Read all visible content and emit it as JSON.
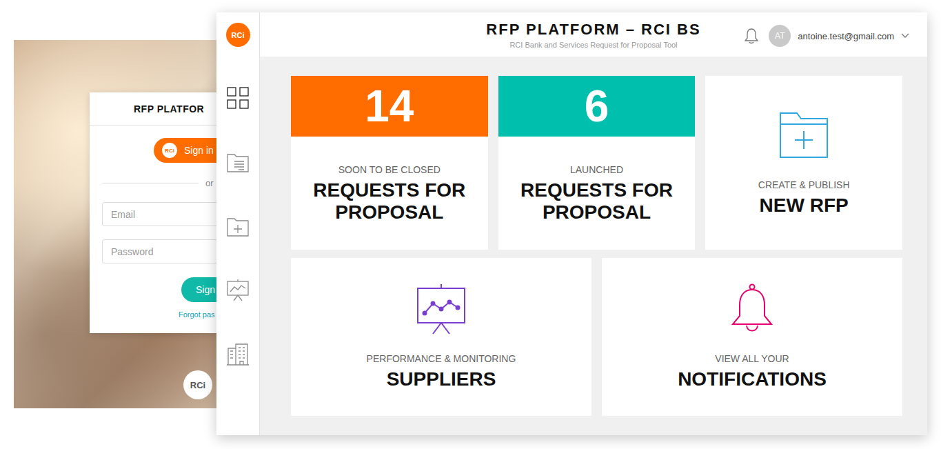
{
  "login": {
    "title": "RFP PLATFOR",
    "sso_logo": "RCi",
    "sso_button": "Sign in",
    "separator": "or",
    "email_placeholder": "Email",
    "password_placeholder": "Password",
    "submit_button": "Sign",
    "forgot_link": "Forgot pas",
    "footer_logo": "RCi"
  },
  "app": {
    "logo": "RCi",
    "title": "RFP PLATFORM – RCI BS",
    "subtitle": "RCI Bank and Services Request for Proposal Tool",
    "user": {
      "initials": "AT",
      "email": "antoine.test@gmail.com"
    }
  },
  "sidebar": {
    "items": [
      {
        "selected": true
      },
      {
        "selected": false
      },
      {
        "selected": false
      },
      {
        "selected": false
      },
      {
        "selected": false
      }
    ]
  },
  "stat_cards": [
    {
      "count": "14",
      "caption": "SOON TO BE CLOSED",
      "title": "REQUESTS FOR PROPOSAL",
      "color": "#ff6d00"
    },
    {
      "count": "6",
      "caption": "LAUNCHED",
      "title": "REQUESTS FOR PROPOSAL",
      "color": "#00c0ad"
    }
  ],
  "action_cards": [
    {
      "caption": "CREATE & PUBLISH",
      "title": "NEW RFP",
      "color": "#2ea8de"
    },
    {
      "caption": "PERFORMANCE & MONITORING",
      "title": "SUPPLIERS",
      "color": "#7a3fd0"
    },
    {
      "caption": "VIEW ALL YOUR",
      "title": "NOTIFICATIONS",
      "color": "#e5006d"
    }
  ]
}
